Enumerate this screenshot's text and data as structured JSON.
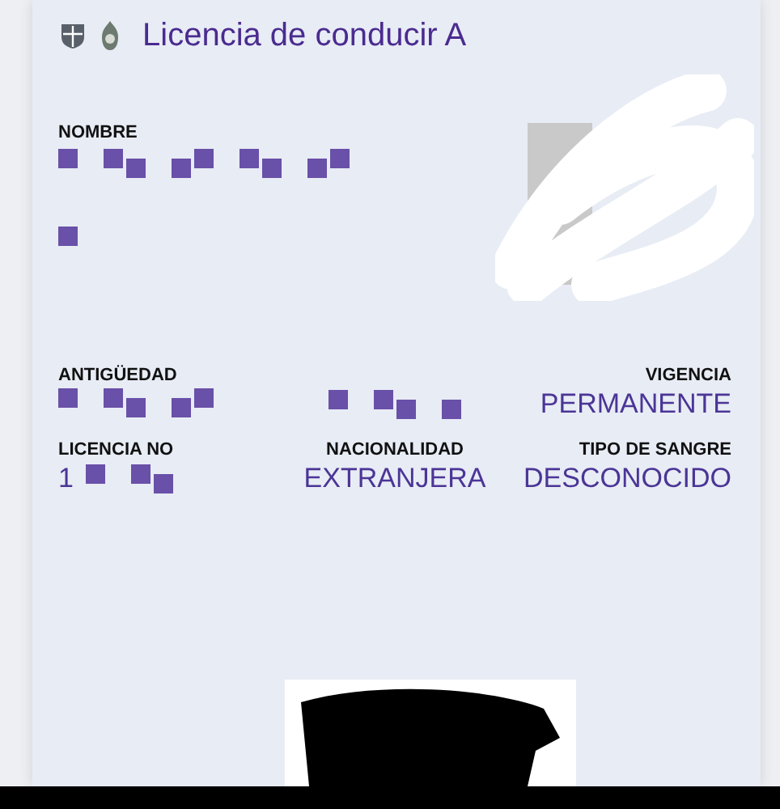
{
  "card": {
    "title": "Licencia de conducir A"
  },
  "name_field": {
    "label": "NOMBRE",
    "kind": "redacted"
  },
  "rows": [
    [
      {
        "label": "ANTIGÜEDAD",
        "kind": "redacted"
      },
      {
        "kind": "redacted"
      },
      {
        "label": "VIGENCIA",
        "kind": "text",
        "value": "PERMANENTE"
      }
    ],
    [
      {
        "label": "LICENCIA NO",
        "kind": "partial",
        "value": "1"
      },
      {
        "label": "NACIONALIDAD",
        "kind": "text",
        "value": "EXTRANJERA"
      },
      {
        "label": "TIPO DE SANGRE",
        "kind": "text",
        "value": "DESCONOCIDO"
      }
    ]
  ]
}
